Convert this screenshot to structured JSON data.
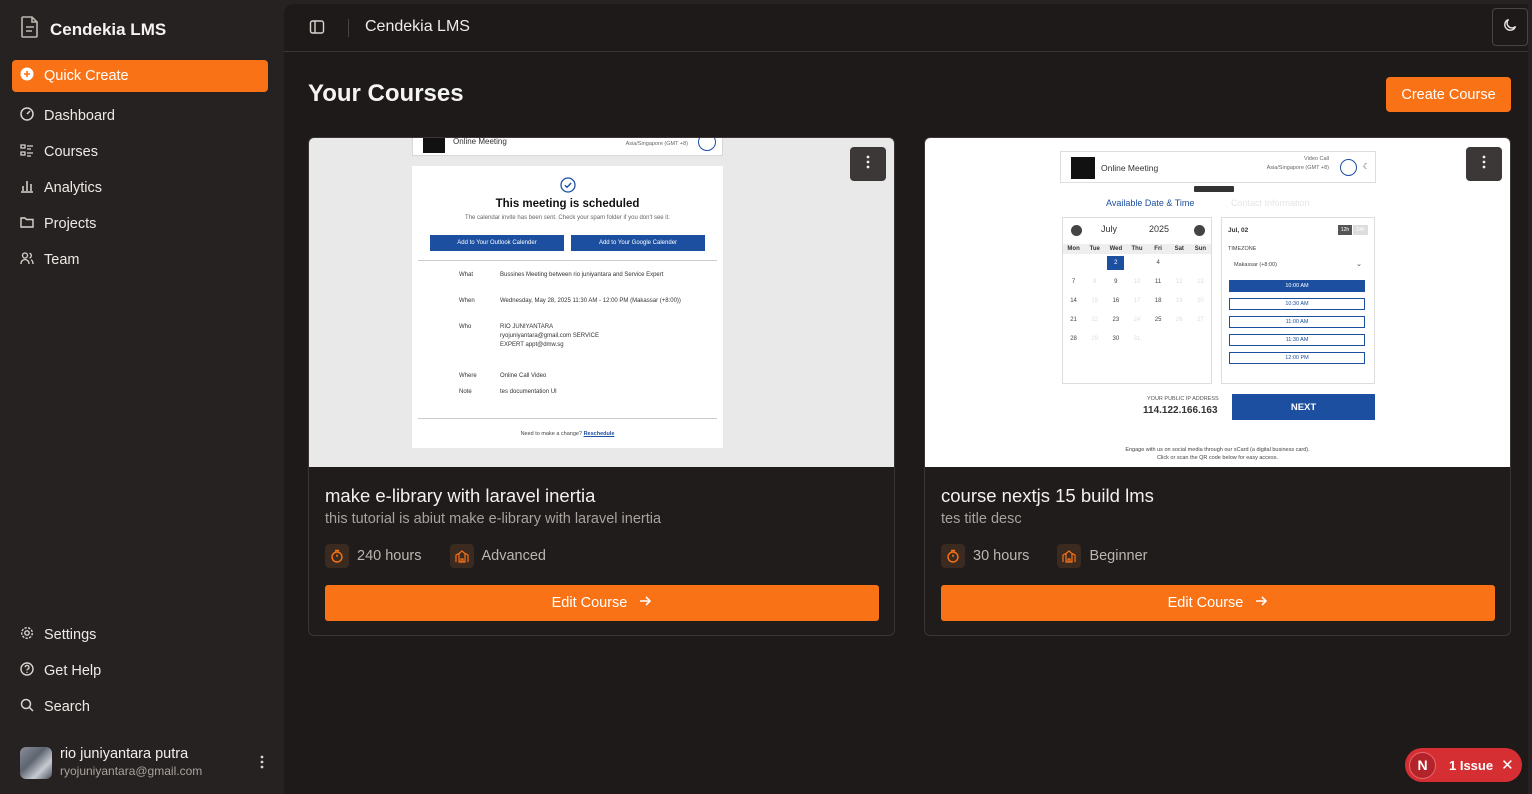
{
  "sidebar": {
    "brand": "Cendekia LMS",
    "quick_create": "Quick Create",
    "nav_top": [
      {
        "label": "Dashboard",
        "icon": "gauge-icon"
      },
      {
        "label": "Courses",
        "icon": "list-icon"
      },
      {
        "label": "Analytics",
        "icon": "bar-chart-icon"
      },
      {
        "label": "Projects",
        "icon": "folder-icon"
      },
      {
        "label": "Team",
        "icon": "users-icon"
      }
    ],
    "nav_bottom": [
      {
        "label": "Settings",
        "icon": "gear-icon"
      },
      {
        "label": "Get Help",
        "icon": "help-circle-icon"
      },
      {
        "label": "Search",
        "icon": "search-icon"
      }
    ],
    "user": {
      "name": "rio juniyantara putra",
      "email": "ryojuniyantara@gmail.com"
    }
  },
  "topbar": {
    "title": "Cendekia LMS"
  },
  "main": {
    "title": "Your Courses",
    "create_button": "Create Course",
    "courses": [
      {
        "title": "make e-library with laravel inertia",
        "description": "this tutorial is abiut make e-library with laravel inertia",
        "duration": "240 hours",
        "level": "Advanced",
        "edit_label": "Edit Course",
        "thumbnail": {
          "header": "Online Meeting",
          "timezone": "Asia/Singapore (GMT +8)",
          "title": "This meeting is scheduled",
          "subtitle": "The calendar invite has been sent. Check your spam folder if you don't see it.",
          "outlook_btn": "Add to Your Outlook Calender",
          "google_btn": "Add to Your Google Calender",
          "rows": [
            {
              "k": "What",
              "v": "Bussines Meeting between rio juniyantara and Service Expert"
            },
            {
              "k": "When",
              "v": "Wednesday, May 28, 2025 11:30 AM - 12:00 PM (Makassar (+8:00))"
            },
            {
              "k": "Who",
              "v": "RIO JUNIYANTARA ryojuniyantara@gmail.com SERVICE EXPERT appt@dmw.sg"
            },
            {
              "k": "Where",
              "v": "Online Call Video"
            },
            {
              "k": "Note",
              "v": "tes documentation UI"
            }
          ],
          "footer": "Need to make a change?",
          "footer_link": "Reschedule"
        }
      },
      {
        "title": "course nextjs 15 build lms",
        "description": "tes title desc",
        "duration": "30 hours",
        "level": "Beginner",
        "edit_label": "Edit Course",
        "thumbnail": {
          "header": "Online Meeting",
          "call_type": "Video Call",
          "timezone": "Asia/Singapore (GMT +8)",
          "tab_active": "Available Date & Time",
          "tab_inactive": "Contact Information",
          "month": "July",
          "year": "2025",
          "weekdays": [
            "Mon",
            "Tue",
            "Wed",
            "Thu",
            "Fri",
            "Sat",
            "Sun"
          ],
          "weeks": [
            [
              "",
              "",
              "2",
              "",
              "4",
              "",
              ""
            ],
            [
              "7",
              "8",
              "9",
              "10",
              "11",
              "12",
              "13"
            ],
            [
              "14",
              "15",
              "16",
              "17",
              "18",
              "19",
              "20"
            ],
            [
              "21",
              "22",
              "23",
              "24",
              "25",
              "26",
              "27"
            ],
            [
              "28",
              "29",
              "30",
              "31",
              "",
              "",
              ""
            ]
          ],
          "date": "Jul, 02",
          "format_12": "12h",
          "format_24": "24h",
          "timezone_label": "TIMEZONE",
          "timezone_value": "Makassar (+8:00)",
          "times": [
            "10:00 AM",
            "10:30 AM",
            "11:00 AM",
            "11:30 AM",
            "12:00 PM"
          ],
          "ip_label": "YOUR PUBLIC IP ADDRESS",
          "ip": "114.122.166.163",
          "next": "NEXT",
          "footer_1": "Engage with us on social media through our sCard (a digital business card).",
          "footer_2": "Click or scan the QR code below for easy access."
        }
      }
    ]
  },
  "issue_badge": {
    "letter": "N",
    "label": "1 Issue"
  },
  "colors": {
    "accent": "#f97316",
    "sidebar_bg": "#262221",
    "main_bg": "#1d1a19",
    "issue": "#d52f34"
  }
}
